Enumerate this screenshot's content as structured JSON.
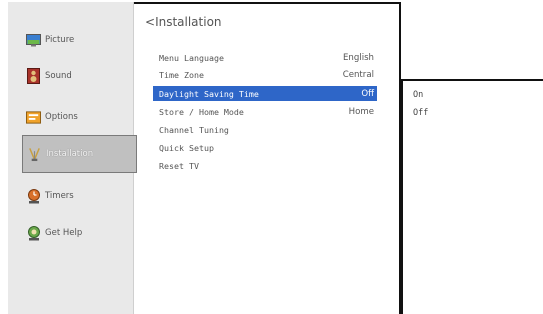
{
  "sidebar": {
    "items": [
      {
        "label": "Picture",
        "icon": "picture-icon"
      },
      {
        "label": "Sound",
        "icon": "sound-icon"
      },
      {
        "label": "Options",
        "icon": "options-icon"
      },
      {
        "label": "Installation",
        "icon": "installation-icon",
        "selected": true
      },
      {
        "label": "Timers",
        "icon": "timers-icon"
      },
      {
        "label": "Get Help",
        "icon": "get-help-icon"
      }
    ]
  },
  "panel": {
    "back_glyph": "<",
    "title": "Installation",
    "rows": [
      {
        "label": "Menu Language",
        "value": "English"
      },
      {
        "label": "Time Zone",
        "value": "Central"
      },
      {
        "label": "Daylight Saving Time",
        "value": "Off",
        "highlighted": true
      },
      {
        "label": "Store / Home Mode",
        "value": "Home"
      },
      {
        "label": "Channel Tuning",
        "value": ""
      },
      {
        "label": "Quick Setup",
        "value": ""
      },
      {
        "label": "Reset TV",
        "value": ""
      }
    ]
  },
  "submenu": {
    "options": [
      "On",
      "Off"
    ]
  },
  "colors": {
    "highlight": "#2e66c8",
    "sidebar_bg": "#e9e9e9",
    "selected_bg": "#c0c0c0"
  }
}
